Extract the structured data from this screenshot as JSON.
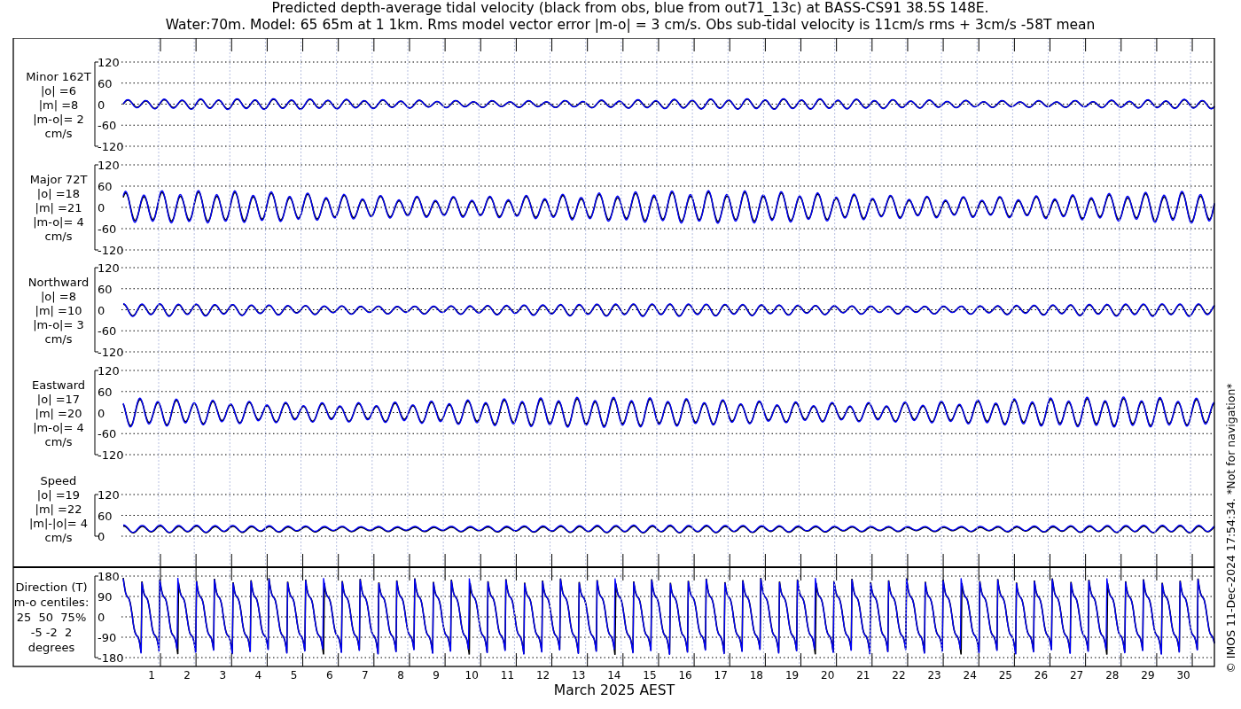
{
  "title_lines": [
    "Predicted depth-average tidal velocity (black from obs, blue from out71_13c) at BASS-CS91 38.5S 148E.",
    "Water:70m. Model: 65 65m at 1 1km. Rms model vector error |m-o| = 3 cm/s. Obs sub-tidal velocity is 11cm/s rms + 3cm/s -58T mean"
  ],
  "panels": [
    {
      "kind": "velocity",
      "label_lines": [
        "Minor 162T",
        "|o| =6",
        "|m| =8",
        "|m-o|= 2",
        "cm/s"
      ],
      "yticks": [
        "120",
        "60",
        "0",
        "-60",
        "-120"
      ]
    },
    {
      "kind": "velocity",
      "label_lines": [
        "Major 72T",
        "|o| =18",
        "|m| =21",
        "|m-o|= 4",
        "cm/s"
      ],
      "yticks": [
        "120",
        "60",
        "0",
        "-60",
        "-120"
      ]
    },
    {
      "kind": "velocity",
      "label_lines": [
        "Northward",
        "|o| =8",
        "|m| =10",
        "|m-o|= 3",
        "cm/s"
      ],
      "yticks": [
        "120",
        "60",
        "0",
        "-60",
        "-120"
      ]
    },
    {
      "kind": "velocity",
      "label_lines": [
        "Eastward",
        "|o| =17",
        "|m| =20",
        "|m-o|= 4",
        "cm/s"
      ],
      "yticks": [
        "120",
        "60",
        "0",
        "-60",
        "-120"
      ]
    },
    {
      "kind": "speed",
      "label_lines": [
        "Speed",
        "|o| =19",
        "|m| =22",
        "|m|-|o|= 4",
        "cm/s"
      ],
      "yticks": [
        "120",
        "60",
        "0"
      ]
    },
    {
      "kind": "direction",
      "label_lines": [
        "Direction (T)",
        "m-o centiles:",
        "25  50  75%",
        "-5 -2  2",
        "degrees"
      ],
      "yticks": [
        "180",
        "90",
        "0",
        "-90",
        "-180"
      ]
    }
  ],
  "xticks": [
    "1",
    "2",
    "3",
    "4",
    "5",
    "6",
    "7",
    "8",
    "9",
    "10",
    "11",
    "12",
    "13",
    "14",
    "15",
    "16",
    "17",
    "18",
    "19",
    "20",
    "21",
    "22",
    "23",
    "24",
    "25",
    "26",
    "27",
    "28",
    "29",
    "30"
  ],
  "xlabel": "March 2025 AEST",
  "credit": "© IMOS 11-Dec-2024 17:54:34. *Not for navigation*"
}
